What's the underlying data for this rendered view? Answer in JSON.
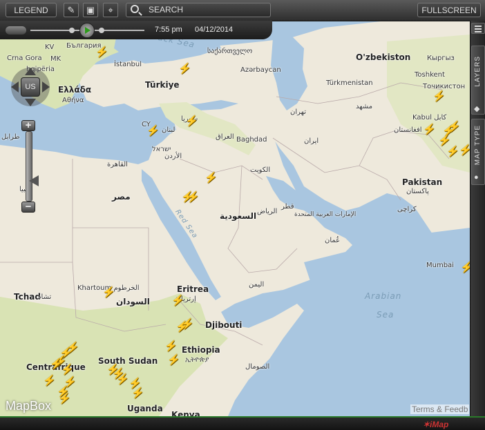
{
  "toolbar": {
    "legend_label": "LEGEND",
    "search_label": "SEARCH",
    "fullscreen_label": "FULLSCREEN",
    "icons": [
      "pencil-icon",
      "screen-icon",
      "route-icon",
      "search-icon"
    ]
  },
  "timebar": {
    "time": "7:55 pm",
    "date": "04/12/2014"
  },
  "side_panel": {
    "layers_label": "LAYERS",
    "map_type_label": "MAP TYPE"
  },
  "nav": {
    "center_label": "US"
  },
  "zoom": {
    "in_label": "+",
    "out_label": "−"
  },
  "attribution": {
    "logo": "MapBox",
    "terms": "Terms & Feedb"
  },
  "map_labels": {
    "black_sea": "Black Sea",
    "red_sea": "Red Sea",
    "arabian_sea": "Arabian",
    "arabian_sea2": "Sea",
    "uzbekistan": "O'zbekiston",
    "kyrgyzstan": "Кыргыз",
    "tajikistan": "Точикистон",
    "turkmenistan": "Türkmenistan",
    "turkey": "Türkiye",
    "azerbaijan": "Azərbaycan",
    "georgia": "საქართველო",
    "bulgaria": "България",
    "kv": "KV",
    "crna_gora": "Crna Gora",
    "mk": "MK",
    "shqiperia": "hqipëria",
    "ellada": "Ελλάδα",
    "athina": "Αθήνα",
    "istanbul": "İstanbul",
    "cy": "CY",
    "lebanon": "لبنان",
    "syria": "سوريا",
    "iraq": "العراق",
    "baghdad": "Baghdad",
    "jordan": "الأردن",
    "israel": "ישראל",
    "cairo": "القاهرة",
    "egypt": "مصر",
    "saudi": "السعودية",
    "riyadh": "الرياض",
    "kuwait": "الكويت",
    "qatar": "قطر",
    "uae": "الإمارات العربية المتحدة",
    "oman": "عُمان",
    "iran": "ایران",
    "tehran": "تهران",
    "mashhad": "مشهد",
    "kabul": "Kabul كابل",
    "afghanistan": "افغانستان",
    "pakistan": "Pakistan",
    "pakistan_ar": "پاکستان",
    "karachi": "کراچی",
    "toshkent": "Toshkent",
    "mumbai": "Mumbai",
    "yemen": "اليمن",
    "eritrea": "Eritrea",
    "eritrea_ar": "إرتريا",
    "djibouti": "Djibouti",
    "ethiopia": "Ethiopia",
    "ethiopia_am": "ኢትዮጵያ",
    "somalia": "الصومال",
    "khartoum": "Khartoum الخرطوم",
    "sudan": "السودان",
    "chad": "Tchad",
    "chad_ar": "تشاد",
    "centrafrique": "Centrafrique",
    "south_sudan": "South Sudan",
    "uganda": "Uganda",
    "kenya": "Kenya",
    "libya": "ليبيا",
    "tarabulus": "طرابل"
  },
  "colors": {
    "water": "#a9c6e0",
    "land": "#eee9dc",
    "vegetation": "#d9e3b4",
    "lightning": "#f2c200"
  }
}
